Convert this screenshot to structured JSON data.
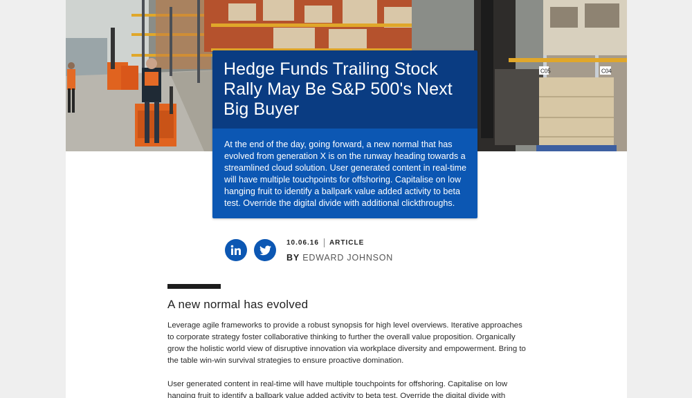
{
  "article": {
    "title": "Hedge Funds Trailing Stock Rally May Be S&P 500's Next Big Buyer",
    "summary": "At the end of the day, going forward, a new normal that has evolved from generation X is on the runway heading towards a streamlined cloud solution. User generated content in real-time will have multiple touchpoints for offshoring. Capitalise on low hanging fruit to identify a ballpark value added activity to beta test. Override the digital divide with additional clickthroughs.",
    "date": "10.06.16",
    "type": "ARTICLE",
    "by_label": "BY",
    "author": "Edward Johnson",
    "subheading": "A new normal has evolved",
    "paragraphs": [
      "Leverage agile frameworks to provide a robust synopsis for high level overviews. Iterative approaches to corporate strategy foster collaborative thinking to further the overall value proposition. Organically grow the holistic world view of disruptive innovation via workplace diversity and empowerment. Bring to the table win-win survival strategies to ensure proactive domination.",
      "User generated content in real-time will have multiple touchpoints for offshoring. Capitalise on low hanging fruit to identify a ballpark value added activity to beta test. Override the digital divide with additional clickthroughs from DevOps."
    ]
  },
  "hero": {
    "rack_labels": [
      "C05",
      "C04"
    ]
  },
  "social": {
    "linkedin_icon": "linkedin-icon",
    "twitter_icon": "twitter-icon"
  },
  "colors": {
    "card_title_bg": "#0a3c82",
    "card_summary_bg": "#0c57b3",
    "social_bg": "#0c57b3",
    "rule": "#1c1c1c"
  }
}
